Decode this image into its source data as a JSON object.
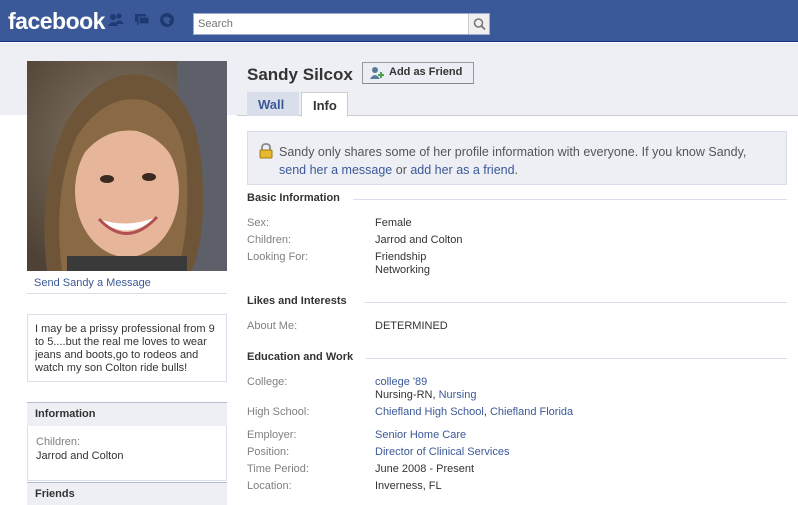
{
  "header": {
    "logo": "facebook",
    "search_placeholder": "Search"
  },
  "profile": {
    "name": "Sandy Silcox",
    "add_friend_label": "Add as Friend",
    "tabs": [
      "Wall",
      "Info"
    ],
    "send_message": "Send Sandy a Message",
    "bio": "I may be a prissy professional from 9 to 5....but the real me loves to wear jeans and boots,go to rodeos and watch my son Colton ride bulls!"
  },
  "left": {
    "information_title": "Information",
    "children_label": "Children:",
    "children_value": "Jarrod and Colton",
    "friends_title": "Friends"
  },
  "privacy": {
    "text1": "Sandy only shares some of her profile information with everyone. If you know Sandy,",
    "link1": "send her a message",
    "or": " or ",
    "link2": "add her as a friend",
    "end": "."
  },
  "basic": {
    "title": "Basic Information",
    "sex_label": "Sex:",
    "sex_value": "Female",
    "children_label": "Children:",
    "children_value": "Jarrod and Colton",
    "looking_label": "Looking For:",
    "looking_value1": "Friendship",
    "looking_value2": "Networking"
  },
  "likes": {
    "title": "Likes and Interests",
    "about_label": "About Me:",
    "about_value": "DETERMINED"
  },
  "education": {
    "title": "Education and Work",
    "college_label": "College:",
    "college_value": "college '89",
    "college_sub1": "Nursing-RN, ",
    "college_sub2": "Nursing",
    "hs_label": "High School:",
    "hs_value1": "Chiefland High School",
    "hs_sep": ", ",
    "hs_value2": "Chiefland Florida",
    "employer_label": "Employer:",
    "employer_value": "Senior Home Care",
    "position_label": "Position:",
    "position_value": "Director of Clinical Services",
    "period_label": "Time Period:",
    "period_value": "June 2008 - Present",
    "location_label": "Location:",
    "location_value": "Inverness, FL"
  }
}
